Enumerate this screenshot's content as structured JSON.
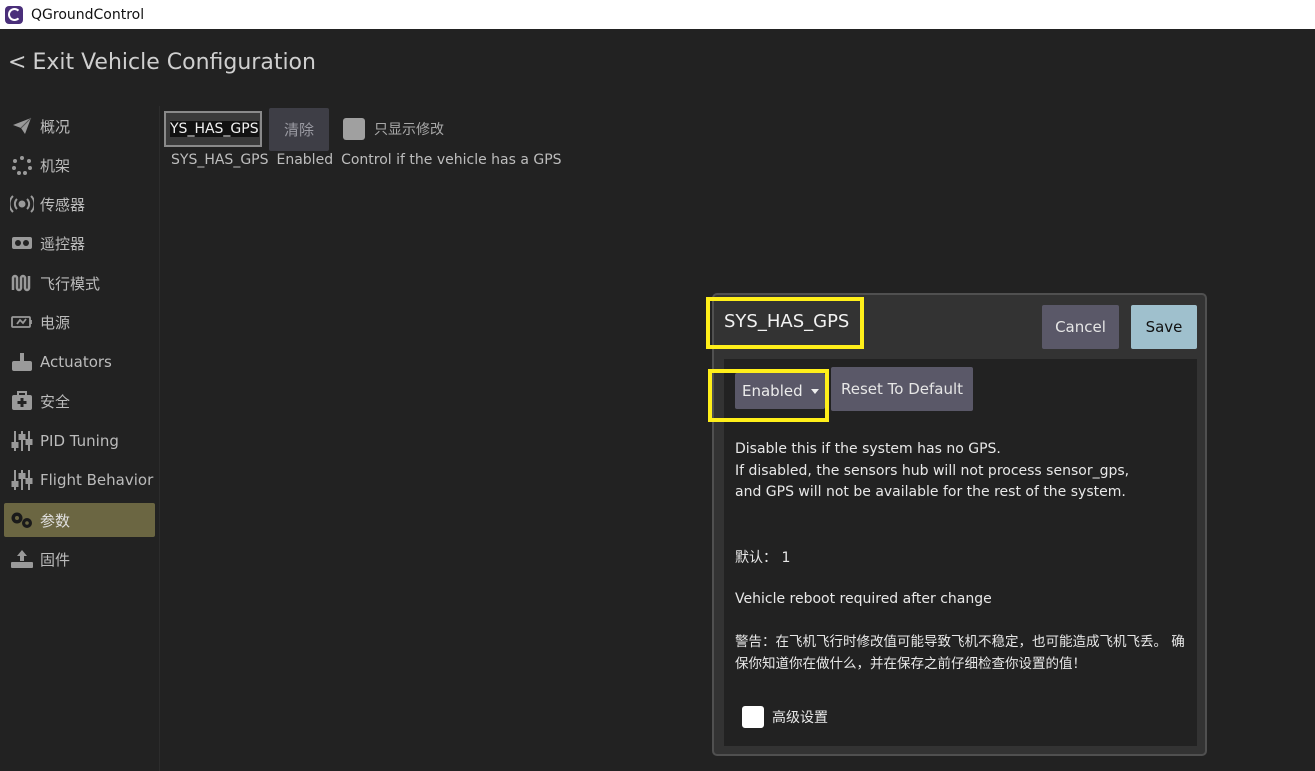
{
  "window": {
    "title": "QGroundControl",
    "icon": "qgc-logo-icon"
  },
  "header": {
    "back_glyph": "<",
    "label": "Exit Vehicle Configuration"
  },
  "sidebar": {
    "items": [
      {
        "label": "概况",
        "icon": "paper-plane-icon"
      },
      {
        "label": "机架",
        "icon": "airframe-dots-icon"
      },
      {
        "label": "传感器",
        "icon": "radio-waves-icon"
      },
      {
        "label": "遥控器",
        "icon": "rc-transmitter-icon"
      },
      {
        "label": "飞行模式",
        "icon": "flight-modes-icon"
      },
      {
        "label": "电源",
        "icon": "battery-icon"
      },
      {
        "label": "Actuators",
        "icon": "actuator-icon"
      },
      {
        "label": "安全",
        "icon": "first-aid-icon"
      },
      {
        "label": "PID Tuning",
        "icon": "sliders-icon"
      },
      {
        "label": "Flight Behavior",
        "icon": "sliders-icon"
      },
      {
        "label": "参数",
        "icon": "gears-icon",
        "active": true
      },
      {
        "label": "固件",
        "icon": "firmware-upload-icon"
      }
    ]
  },
  "search": {
    "value": "YS_HAS_GPS",
    "clear_label": "清除",
    "only_changed_label": "只显示修改"
  },
  "param_row": {
    "name": "SYS_HAS_GPS",
    "value": "Enabled",
    "description": "Control if the vehicle has a GPS"
  },
  "dialog": {
    "title": "SYS_HAS_GPS",
    "cancel_label": "Cancel",
    "save_label": "Save",
    "selected_value": "Enabled",
    "reset_label": "Reset To Default",
    "description_lines": [
      "Disable this if the system has no GPS.",
      "If disabled, the sensors hub will not process sensor_gps,",
      "and GPS will not be available for the rest of the system."
    ],
    "default_label": "默认：",
    "default_value": "1",
    "reboot_notice": "Vehicle reboot required after change",
    "warning": "警告：在飞机飞行时修改值可能导致飞机不稳定，也可能造成飞机飞丢。 确保你知道你在做什么，并在保存之前仔细检查你设置的值！",
    "advanced_label": "高级设置"
  },
  "colors": {
    "highlight": "#ffef1a",
    "active_nav": "#6b6642",
    "save": "#9fc0cd",
    "button": "#5a5868"
  }
}
